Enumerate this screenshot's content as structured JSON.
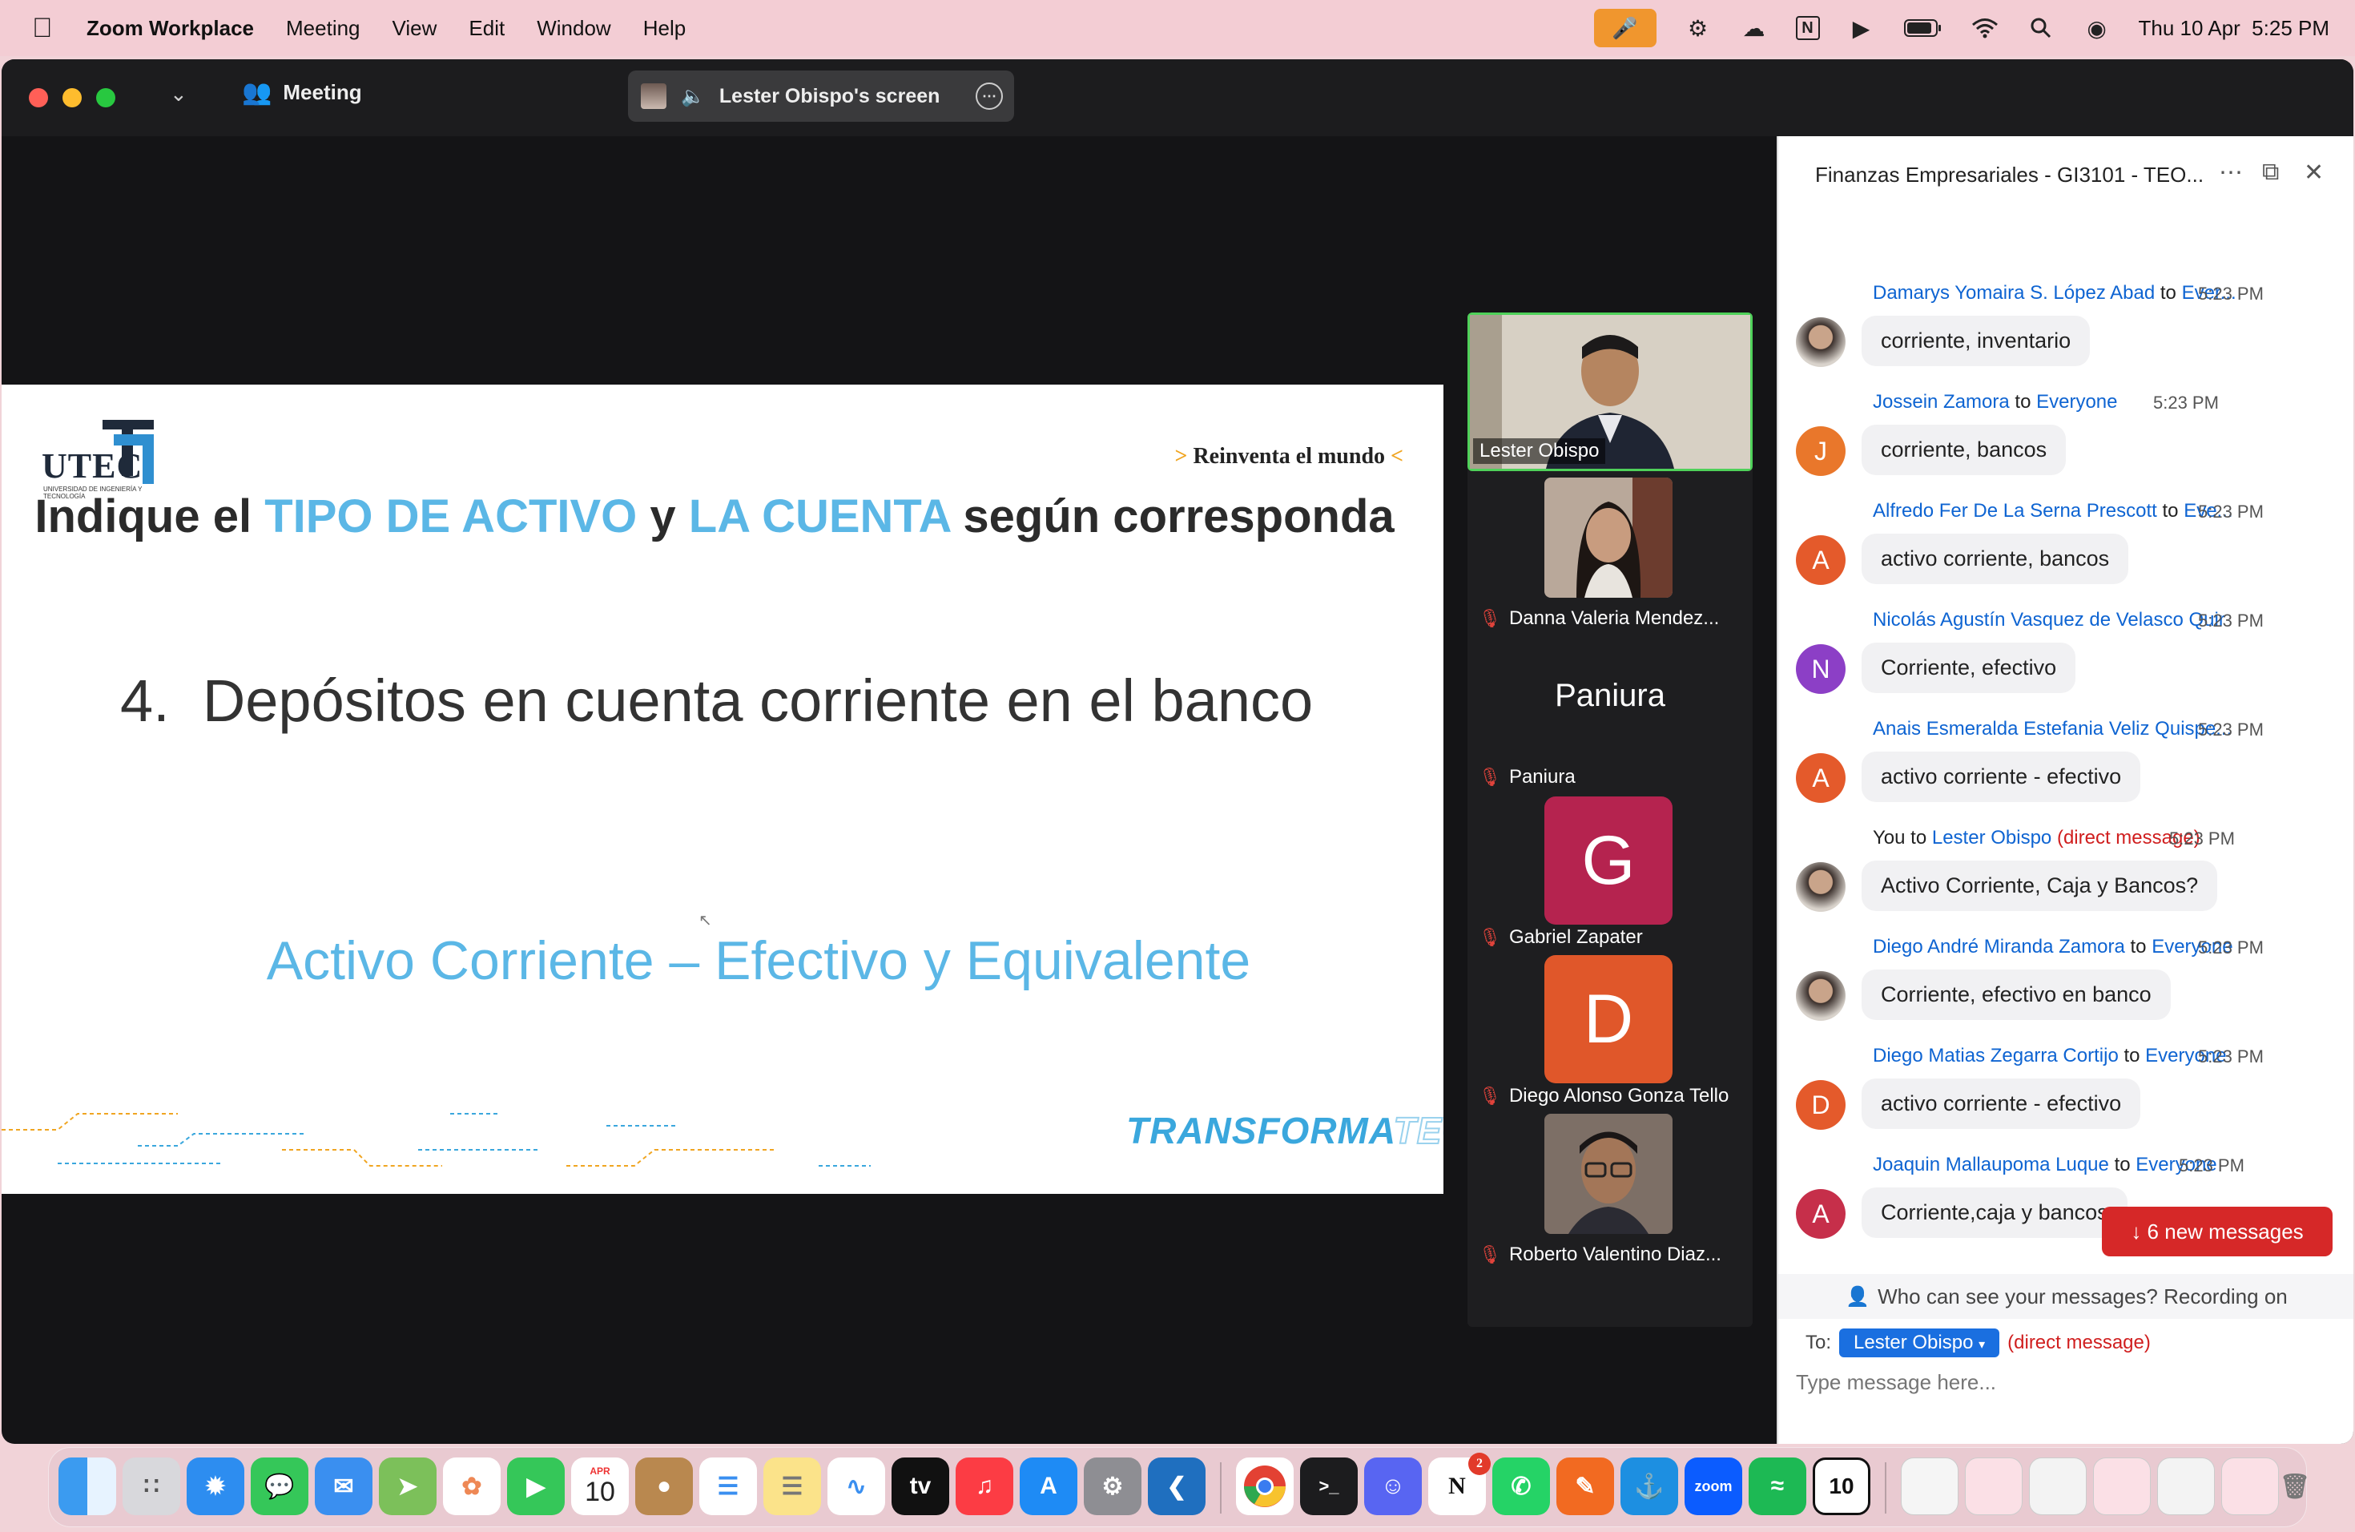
{
  "menubar": {
    "app_name": "Zoom Workplace",
    "items": [
      "Meeting",
      "View",
      "Edit",
      "Window",
      "Help"
    ],
    "datetime": "Thu 10 Apr  5:25 PM"
  },
  "window": {
    "meeting_label": "Meeting",
    "screen_share_label": "Lester Obispo's screen"
  },
  "slide": {
    "brand": "UTEC",
    "brand_sub": "UNIVERSIDAD DE INGENIERÍA Y TECNOLOGÍA",
    "tagline_pre": "> ",
    "tagline": "Reinventa el mundo",
    "tagline_post": " <",
    "title_part1": "Indique el ",
    "title_hl1": "TIPO DE ACTIVO",
    "title_part2": " y ",
    "title_hl2": "LA CUENTA",
    "title_part3": " según corresponda",
    "question": "4.  Depósitos en cuenta corriente en el banco",
    "answer": "Activo Corriente – Efectivo y Equivalente",
    "footer_brand_a": "TRANSFORMA",
    "footer_brand_b": "TEC"
  },
  "participants": [
    {
      "name": "Lester Obispo",
      "type": "video"
    },
    {
      "name": "Danna Valeria Mendez...",
      "type": "video"
    },
    {
      "name": "Paniura",
      "display": "Paniura",
      "type": "name"
    },
    {
      "name": "Gabriel Zapater",
      "letter": "G",
      "color": "#b5234f",
      "type": "letter"
    },
    {
      "name": "Diego Alonso Gonza Tello",
      "letter": "D",
      "color": "#e0572a",
      "type": "letter"
    },
    {
      "name": "Roberto Valentino Diaz...",
      "type": "video"
    }
  ],
  "chat": {
    "title": "Finanzas Empresariales - GI3101 - TEO...",
    "messages": [
      {
        "sender": "Damarys Yomaira S. López Abad",
        "to": "to",
        "recipient": "Ever...",
        "time": "5:23 PM",
        "text": "corriente, inventario",
        "avatar": "photo"
      },
      {
        "sender": "Jossein  Zamora",
        "to": "to",
        "recipient": "Everyone",
        "time": "5:23 PM",
        "text": "corriente, bancos",
        "avatar": "J",
        "color": "#e9772b"
      },
      {
        "sender": "Alfredo Fer De La Serna Prescott",
        "to": "to",
        "recipient": "Eve...",
        "time": "5:23 PM",
        "text": "activo corriente, bancos",
        "avatar": "A",
        "color": "#e45a2b"
      },
      {
        "sender": "Nicolás Agustín Vasquez de Velasco Quir",
        "to": "",
        "recipient": "",
        "time": "5:23 PM",
        "text": "Corriente, efectivo",
        "avatar": "N",
        "color": "#8c3fc6"
      },
      {
        "sender": "Anais Esmeralda Estefania Veliz Quispe...",
        "to": "",
        "recipient": "",
        "time": "5:23 PM",
        "text": "activo corriente - efectivo",
        "avatar": "A",
        "color": "#e45a2b"
      },
      {
        "sender": "You",
        "to": "to",
        "recipient": "Lester Obispo",
        "direct": "(direct message)",
        "time": "5:23 PM",
        "text": "Activo Corriente, Caja y Bancos?",
        "avatar": "photo",
        "self": true
      },
      {
        "sender": "Diego André Miranda Zamora",
        "to": "to",
        "recipient": "Everyone",
        "time": "5:23 PM",
        "text": "Corriente, efectivo en banco",
        "avatar": "photo"
      },
      {
        "sender": "Diego Matias Zegarra Cortijo",
        "to": "to",
        "recipient": "Everyone",
        "time": "5:23 PM",
        "text": "activo corriente - efectivo",
        "avatar": "D",
        "color": "#e45a2b"
      },
      {
        "sender": "Joaquin Mallaupoma Luque",
        "to": "to",
        "recipient": "Everyone",
        "time": "5:23 PM",
        "text": "Corriente,caja y bancos",
        "avatar": "A",
        "color": "#c62f4a"
      }
    ],
    "new_messages": "↓ 6 new messages",
    "privacy_notice": "Who can see your messages? Recording on",
    "to_label": "To:",
    "to_recipient": "Lester Obispo",
    "to_direct": "(direct message)",
    "input_placeholder": "Type message here..."
  },
  "dock": {
    "calendar_month": "APR",
    "calendar_day": "10",
    "notion_badge": "2",
    "zoom_label": "zoom"
  }
}
